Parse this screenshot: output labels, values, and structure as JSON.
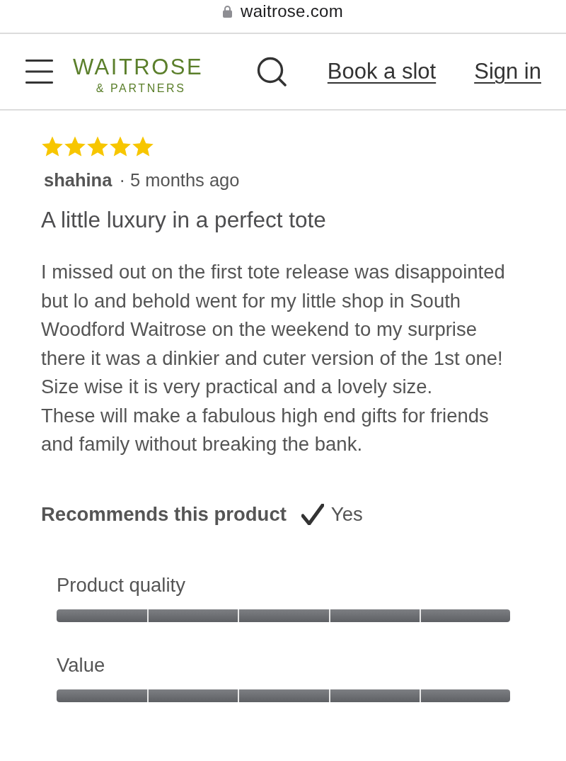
{
  "browser": {
    "url": "waitrose.com"
  },
  "header": {
    "logo": {
      "name": "WAITROSE",
      "tagline": "& PARTNERS"
    },
    "links": [
      "Book a slot",
      "Sign in"
    ]
  },
  "review": {
    "stars": 5,
    "author": "shahina",
    "time": "· 5 months ago",
    "title": "A little luxury in a perfect tote",
    "body": [
      "I missed out on the first tote release was disappointed but lo and behold went for my little shop in South Woodford Waitrose on the weekend to my surprise there it was a dinkier and cuter version of the 1st one! Size wise it is very practical and a lovely size.",
      "These will make a fabulous high end gifts for friends and family without breaking the bank."
    ],
    "recommends": {
      "label": "Recommends this product",
      "checked": true,
      "answer": "Yes"
    },
    "ratings": [
      {
        "label": "Product quality",
        "level": 1
      },
      {
        "label": "Value",
        "level": 1
      }
    ]
  }
}
